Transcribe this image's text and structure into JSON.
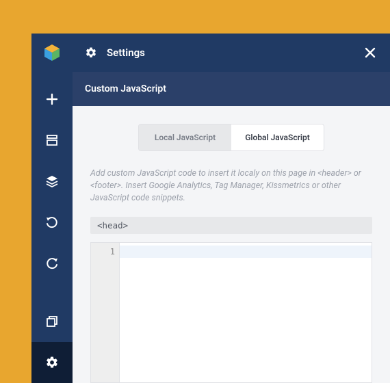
{
  "header": {
    "title": "Settings"
  },
  "subheader": {
    "title": "Custom JavaScript"
  },
  "tabs": {
    "local": "Local JavaScript",
    "global": "Global JavaScript"
  },
  "description": "Add custom JavaScript code to insert it localy on this page in <header> or <footer>. Insert Google Analytics, Tag Manager, Kissmetrics or other JavaScript code snippets.",
  "section_tag": "<head>",
  "editor": {
    "line_numbers": [
      "1"
    ],
    "content": ""
  },
  "sidebar": {
    "items": [
      "add",
      "template",
      "layers",
      "undo",
      "redo"
    ],
    "bottom": [
      "window",
      "settings"
    ]
  }
}
